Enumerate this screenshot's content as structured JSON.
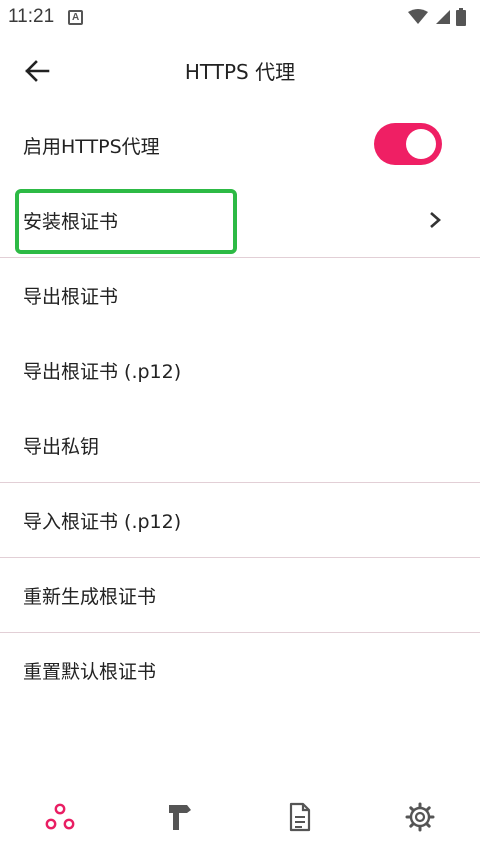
{
  "status_bar": {
    "time": "11:21",
    "notification_icon": "a-icon"
  },
  "header": {
    "title": "HTTPS 代理",
    "back_icon": "arrow-left-icon"
  },
  "rows": {
    "enable": "启用HTTPS代理",
    "install": "安装根证书",
    "export": "导出根证书",
    "export_p12": "导出根证书 (.p12)",
    "export_key": "导出私钥",
    "import_p12": "导入根证书 (.p12)",
    "regenerate": "重新生成根证书",
    "reset": "重置默认根证书"
  },
  "toggle": {
    "state": "on",
    "color": "#ef1f64"
  },
  "highlight_color": "#2dba45",
  "accent_color": "#e91e63",
  "bottom_nav": [
    "network-icon",
    "hammer-icon",
    "document-icon",
    "gear-icon"
  ]
}
